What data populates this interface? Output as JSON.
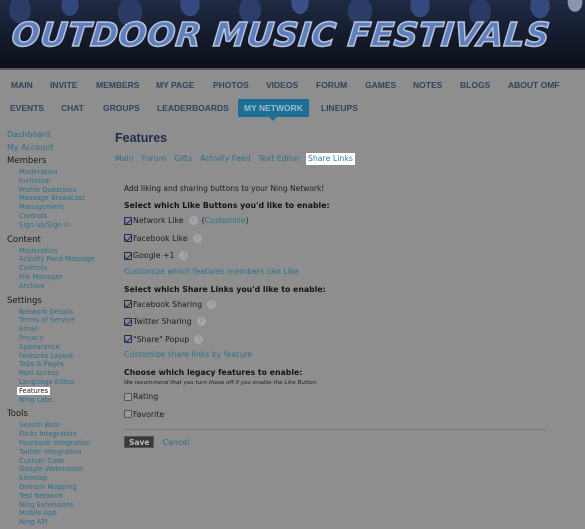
{
  "banner": {
    "title": "OUTDOOR MUSIC FESTIVALS"
  },
  "nav": {
    "row1": [
      {
        "label": "MAIN"
      },
      {
        "label": "INVITE"
      },
      {
        "label": "MEMBERS"
      },
      {
        "label": "MY PAGE"
      },
      {
        "label": "PHOTOS"
      },
      {
        "label": "VIDEOS"
      },
      {
        "label": "FORUM"
      },
      {
        "label": "GAMES"
      },
      {
        "label": "NOTES"
      },
      {
        "label": "BLOGS"
      },
      {
        "label": "ABOUT OMF"
      }
    ],
    "row2": [
      {
        "label": "EVENTS"
      },
      {
        "label": "CHAT"
      },
      {
        "label": "GROUPS"
      },
      {
        "label": "LEADERBOARDS"
      },
      {
        "label": "MY NETWORK",
        "active": true
      },
      {
        "label": "LINEUPS"
      }
    ],
    "active_color": "#1d6f96"
  },
  "sidebar": {
    "top_links": [
      "Dashboard",
      "My Account"
    ],
    "sections": [
      {
        "heading": "Members",
        "items": [
          "Moderation",
          "Invitation",
          "Profile Questions",
          "Message Broadcast",
          "Management",
          "Controls",
          "Sign up/Sign in"
        ]
      },
      {
        "heading": "Content",
        "items": [
          "Moderation",
          "Activity Feed Message",
          "Controls",
          "File Manager",
          "Archive"
        ]
      },
      {
        "heading": "Settings",
        "items": [
          "Network Details",
          "Terms of Service",
          "Email",
          "Privacy",
          "Appearance",
          "Features Layout",
          "Tabs & Pages",
          "Paid Access",
          "Language Editor",
          "Features",
          "Ning Labs"
        ],
        "active_item": "Features"
      },
      {
        "heading": "Tools",
        "items": [
          "Search Bots",
          "Flickr Integration",
          "Facebook Integration",
          "Twitter Integration",
          "Custom Code",
          "Google Webmaster",
          "Sitemap",
          "Domain Mapping",
          "Test Network",
          "Ning Extensions",
          "Mobile App",
          "Ning API"
        ]
      }
    ]
  },
  "main": {
    "title": "Features",
    "subtabs": [
      {
        "label": "Main"
      },
      {
        "label": "Forum"
      },
      {
        "label": "Gifts"
      },
      {
        "label": "Activity Feed"
      },
      {
        "label": "Text Editor"
      },
      {
        "label": "Share Links",
        "active": true
      }
    ],
    "intro": "Add liking and sharing buttons to your Ning Network!",
    "like_section": {
      "heading": "Select which Like Buttons you'd like to enable:",
      "options": [
        {
          "label": "Network Like",
          "checked": true,
          "customize_label": "Customize"
        },
        {
          "label": "Facebook Like",
          "checked": true
        },
        {
          "label": "Google +1",
          "checked": true
        }
      ],
      "link": "Customize which features members can Like"
    },
    "share_section": {
      "heading": "Select which Share Links you'd like to enable:",
      "options": [
        {
          "label": "Facebook Sharing",
          "checked": true
        },
        {
          "label": "Twitter Sharing",
          "checked": true
        },
        {
          "label": "\"Share\" Popup",
          "checked": true
        }
      ],
      "link": "Customize share links by feature"
    },
    "legacy_section": {
      "heading": "Choose which legacy features to enable:",
      "note": "We recommend that you turn these off if you enable the Like Button.",
      "options": [
        {
          "label": "Rating",
          "checked": false
        },
        {
          "label": "Favorite",
          "checked": false
        }
      ]
    },
    "actions": {
      "save_label": "Save",
      "cancel_label": "Cancel"
    },
    "help_icon_glyph": "?"
  }
}
